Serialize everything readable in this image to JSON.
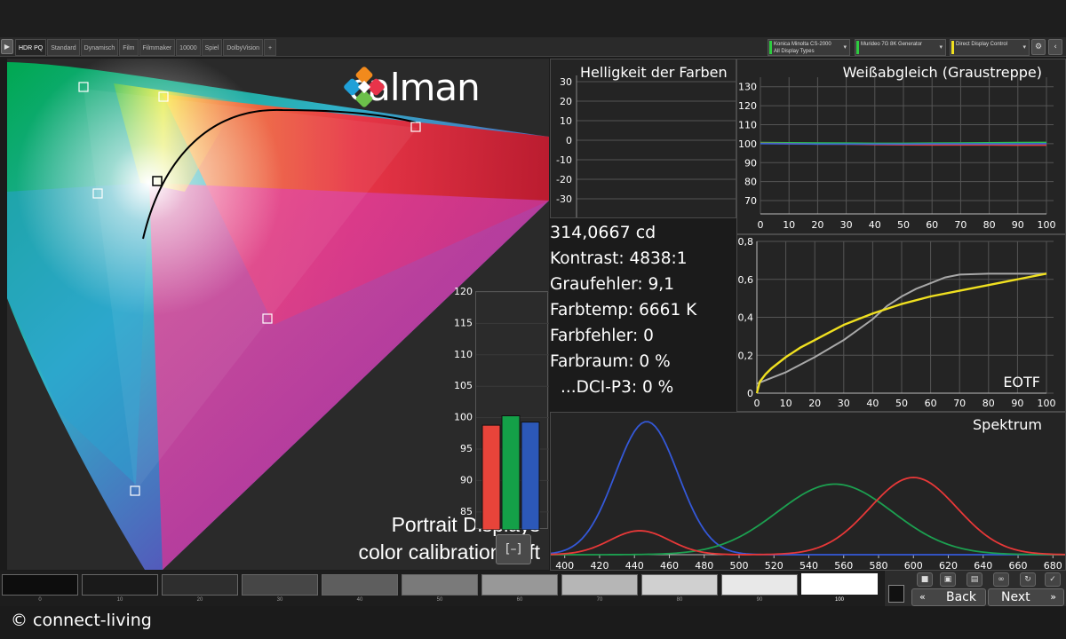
{
  "tabbar": {
    "nav_icon": "play-icon",
    "tabs": [
      "HDR PQ",
      "Standard",
      "Dynamisch",
      "Film",
      "Filmmaker",
      "10000",
      "Spiel",
      "DolbyVision"
    ],
    "active_tab": "HDR PQ",
    "add_tab_icon": "plus-icon",
    "devices": [
      {
        "line1": "Konica Minolta CS-2000",
        "line2": "All Display Types",
        "color": "#2ecc40"
      },
      {
        "line1": "Murideo 7G 8K Generator",
        "line2": "",
        "color": "#2ecc40"
      },
      {
        "line1": "Direct Display Control",
        "line2": "",
        "color": "#f0e020"
      }
    ],
    "settings_icon": "gear-icon",
    "collapse_icon": "chevron-left-icon"
  },
  "cie": {
    "logo_text": "calman",
    "logo_icon": "calman-diamond-logo",
    "watermark_line1": "Portrait Displays",
    "watermark_line2": "color calibration soft"
  },
  "luminance_bars": {
    "y_ticks": [
      "120",
      "115",
      "110",
      "105",
      "100",
      "95",
      "90",
      "85"
    ],
    "ymin": 83,
    "ymax": 120,
    "bars": [
      {
        "name": "red",
        "value": 98.8,
        "color": "#e8443a"
      },
      {
        "name": "green",
        "value": 100.3,
        "color": "#14a048"
      },
      {
        "name": "blue",
        "value": 99.3,
        "color": "#2c58b8"
      }
    ],
    "overlay_icon": "target-bracket-icon"
  },
  "brightness": {
    "title": "Helligkeit der Farben",
    "y_ticks": [
      "30",
      "20",
      "10",
      "0",
      "-10",
      "-20",
      "-30"
    ]
  },
  "stats": {
    "luminance": "314,0667 cd",
    "contrast": "Kontrast: 4838:1",
    "gray_error": "Graufehler: 9,1",
    "color_temp": "Farbtemp: 6661 K",
    "color_error": "Farbfehler: 0",
    "gamut": "Farbraum: 0 %",
    "dci": "...DCI-P3: 0 %"
  },
  "whitebalance": {
    "title": "Weißabgleich (Graustreppe)",
    "y_ticks": [
      "130",
      "120",
      "110",
      "100",
      "90",
      "80",
      "70"
    ],
    "x_ticks": [
      "0",
      "10",
      "20",
      "30",
      "40",
      "50",
      "60",
      "70",
      "80",
      "90",
      "100"
    ],
    "ymin": 63,
    "ymax": 135,
    "series": [
      {
        "color": "#2bc050",
        "values": [
          100.6,
          100.5,
          100.4,
          100.3,
          100.2,
          100.2,
          100.3,
          100.4,
          100.5,
          100.6,
          100.7
        ]
      },
      {
        "color": "#e84040",
        "values": [
          100.2,
          100.0,
          99.8,
          99.7,
          99.5,
          99.4,
          99.3,
          99.3,
          99.3,
          99.2,
          99.2
        ]
      },
      {
        "color": "#3a66d8",
        "values": [
          100.0,
          99.9,
          99.8,
          99.8,
          99.8,
          99.8,
          99.9,
          99.9,
          99.9,
          99.9,
          100.0
        ]
      }
    ]
  },
  "eotf": {
    "title": "EOTF",
    "y_ticks": [
      "0,8",
      "0,6",
      "0,4",
      "0,2",
      "0"
    ],
    "x_ticks": [
      "0",
      "10",
      "20",
      "30",
      "40",
      "50",
      "60",
      "70",
      "80",
      "90",
      "100"
    ],
    "ymin": 0,
    "ymax": 0.8,
    "series": [
      {
        "color": "#f0e020",
        "points": [
          [
            0,
            0.0
          ],
          [
            1,
            0.06
          ],
          [
            3,
            0.1
          ],
          [
            5,
            0.13
          ],
          [
            10,
            0.19
          ],
          [
            15,
            0.24
          ],
          [
            20,
            0.28
          ],
          [
            25,
            0.32
          ],
          [
            30,
            0.36
          ],
          [
            35,
            0.39
          ],
          [
            40,
            0.42
          ],
          [
            50,
            0.47
          ],
          [
            60,
            0.51
          ],
          [
            70,
            0.54
          ],
          [
            80,
            0.57
          ],
          [
            90,
            0.6
          ],
          [
            100,
            0.63
          ]
        ]
      },
      {
        "color": "#a8a8a8",
        "points": [
          [
            0,
            0.05
          ],
          [
            10,
            0.11
          ],
          [
            20,
            0.19
          ],
          [
            30,
            0.28
          ],
          [
            40,
            0.39
          ],
          [
            45,
            0.46
          ],
          [
            50,
            0.51
          ],
          [
            55,
            0.55
          ],
          [
            60,
            0.58
          ],
          [
            65,
            0.61
          ],
          [
            70,
            0.625
          ],
          [
            80,
            0.63
          ],
          [
            90,
            0.63
          ],
          [
            100,
            0.63
          ]
        ]
      }
    ]
  },
  "spectrum": {
    "title": "Spektrum",
    "x_ticks": [
      "400",
      "420",
      "440",
      "460",
      "480",
      "500",
      "520",
      "540",
      "560",
      "580",
      "600",
      "620",
      "640",
      "660",
      "680"
    ],
    "xmin": 392,
    "xmax": 688,
    "series": [
      {
        "name": "blue",
        "color": "#3458d8",
        "peak": 447,
        "width": 18,
        "amp": 1.0
      },
      {
        "name": "green",
        "color": "#1ca050",
        "peak": 555,
        "width": 33,
        "amp": 0.53
      },
      {
        "name": "red",
        "color": "#e83838",
        "peak": 600,
        "width": 25,
        "amp": 0.58
      },
      {
        "name": "red-minor",
        "color": "#e83838",
        "peak": 443,
        "width": 17,
        "amp": 0.18
      }
    ]
  },
  "swatches": {
    "labels": [
      "0",
      "10",
      "20",
      "30",
      "40",
      "50",
      "60",
      "70",
      "80",
      "90",
      "100"
    ],
    "colors": [
      "#0d0d0d",
      "#1a1a1a",
      "#2e2e2e",
      "#464646",
      "#5e5e5e",
      "#7a7a7a",
      "#989898",
      "#b6b6b6",
      "#d0d0d0",
      "#e8e8e8",
      "#ffffff"
    ],
    "active_index": 10
  },
  "controls": {
    "icons": [
      "stop-icon",
      "floppy-icon",
      "floppy-arrow-icon",
      "link-icon",
      "refresh-icon",
      "checkmark-icon"
    ],
    "back_label": "Back",
    "next_label": "Next",
    "back_icon": "double-chevron-left-icon",
    "next_icon": "double-chevron-right-icon",
    "preview_icon": "pattern-preview-icon"
  },
  "footer": {
    "copyright": "© connect-living"
  }
}
